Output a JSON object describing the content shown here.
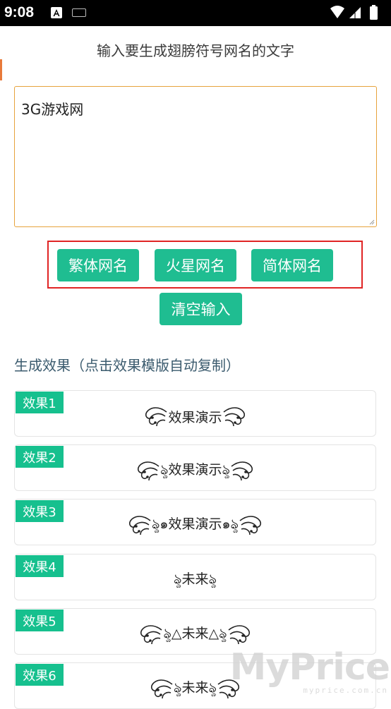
{
  "status_bar": {
    "time": "9:08",
    "icons": [
      "a-notification-icon",
      "keyboard-icon",
      "wifi-icon",
      "cellular-icon",
      "battery-icon"
    ]
  },
  "header": {
    "prompt": "输入要生成翅膀符号网名的文字"
  },
  "input": {
    "value": "3G游戏网"
  },
  "buttons": {
    "traditional": "繁体网名",
    "martian": "火星网名",
    "simplified": "简体网名",
    "clear": "清空输入"
  },
  "results": {
    "title": "生成效果（点击效果模版自动复制）",
    "items": [
      {
        "label": "效果1",
        "preview": "效果演示"
      },
      {
        "label": "效果2",
        "preview": "ৡ效果演示ৡ"
      },
      {
        "label": "效果3",
        "preview": "ৡ๑效果演示๑ৡ"
      },
      {
        "label": "效果4",
        "preview": "ৡ未来ৡ"
      },
      {
        "label": "效果5",
        "preview": "ৡ△未来△ৡ"
      },
      {
        "label": "效果6",
        "preview": "ৡ未来ৡ"
      }
    ]
  },
  "watermark": {
    "brand": "MyPrice",
    "url": "myprice.com.cn"
  },
  "colors": {
    "accent_green": "#1fbd91",
    "badge_green": "#16c08e",
    "highlight_red": "#e02424",
    "input_border": "#e7a33c"
  }
}
